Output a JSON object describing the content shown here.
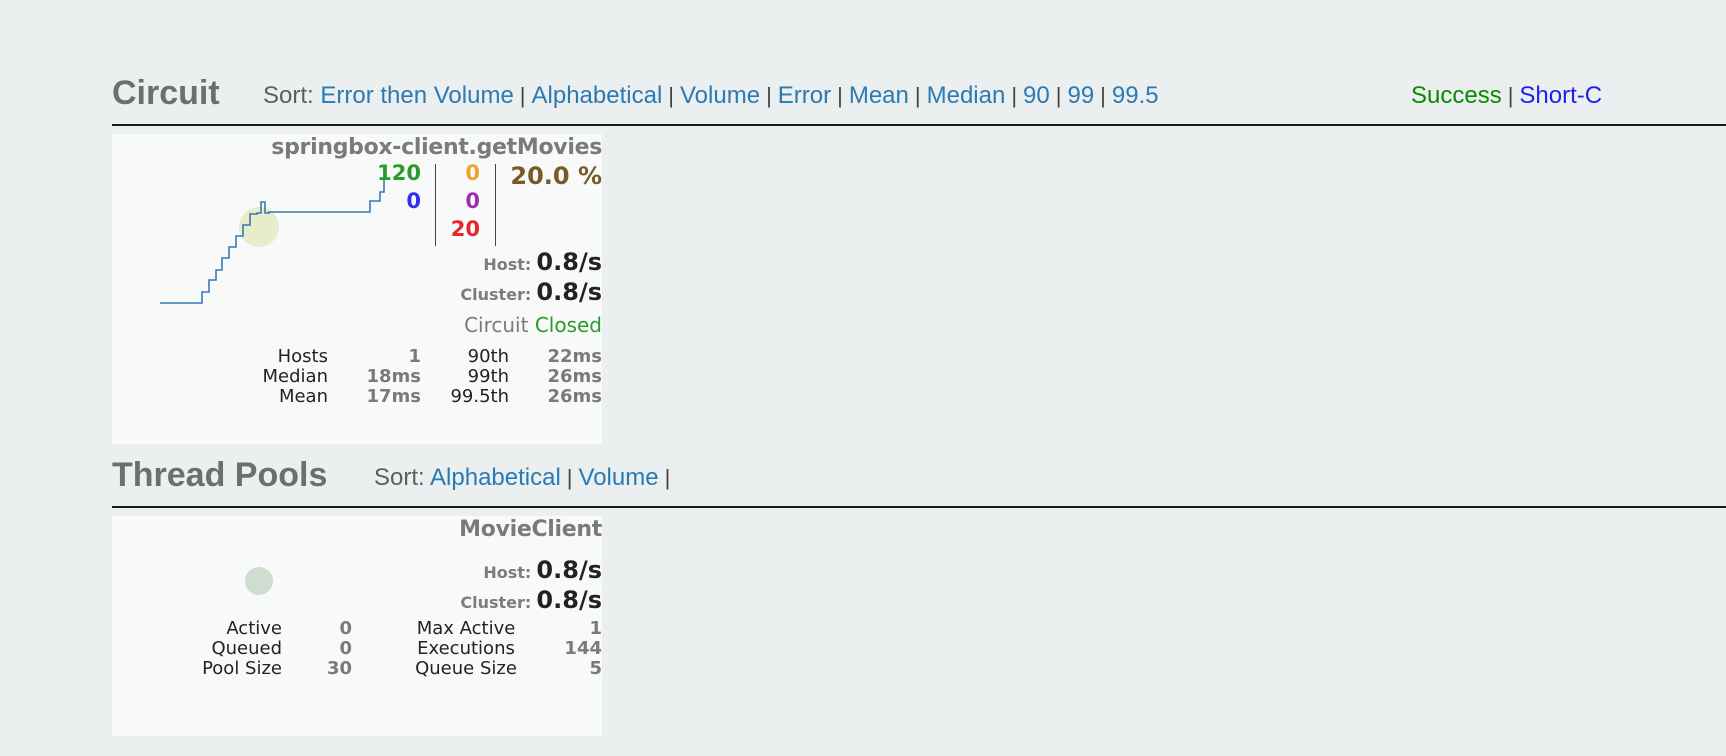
{
  "circuit_section": {
    "title": "Circuit",
    "sort_label": "Sort:",
    "sort_options": [
      "Error then Volume",
      "Alphabetical",
      "Volume",
      "Error",
      "Mean",
      "Median",
      "90",
      "99",
      "99.5"
    ],
    "legend": [
      {
        "label": "Success",
        "color": "#098a00"
      },
      {
        "label": "Short-C",
        "color": "#1f1fef"
      }
    ]
  },
  "circuit_card": {
    "name": "springbox-client.getMovies",
    "counts": {
      "success": "120",
      "short_circuited": "0",
      "timeout": "0",
      "rejected": "0",
      "failure": "20",
      "error_pct": "20.0 %"
    },
    "colors": {
      "success": "#2a9a2a",
      "short_circuited": "#2f2ff0",
      "timeout": "#f0a32c",
      "rejected": "#9b2fae",
      "failure": "#e8242c",
      "error_pct": "#7a5a24"
    },
    "host_label": "Host:",
    "host_rate": "0.8/s",
    "cluster_label": "Cluster:",
    "cluster_rate": "0.8/s",
    "circuit_label": "Circuit",
    "circuit_status": "Closed",
    "stats": {
      "col1_labels": [
        "Hosts",
        "Median",
        "Mean"
      ],
      "col1_values": [
        "1",
        "18ms",
        "17ms"
      ],
      "col2_labels": [
        "90th",
        "99th",
        "99.5th"
      ],
      "col2_values": [
        "22ms",
        "26ms",
        "26ms"
      ]
    }
  },
  "thread_section": {
    "title": "Thread Pools",
    "sort_label": "Sort:",
    "sort_options": [
      "Alphabetical",
      "Volume"
    ]
  },
  "thread_card": {
    "name": "MovieClient",
    "host_label": "Host:",
    "host_rate": "0.8/s",
    "cluster_label": "Cluster:",
    "cluster_rate": "0.8/s",
    "stats": {
      "col1_labels": [
        "Active",
        "Queued",
        "Pool Size"
      ],
      "col1_values": [
        "0",
        "0",
        "30"
      ],
      "col2_labels": [
        "Max Active",
        "Executions",
        "Queue Size"
      ],
      "col2_values": [
        "1",
        "144",
        "5"
      ]
    }
  }
}
